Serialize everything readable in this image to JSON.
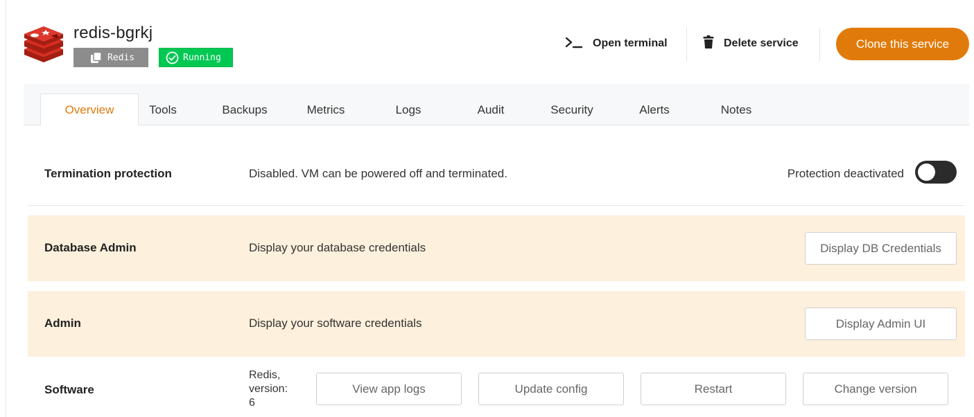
{
  "service": {
    "name": "redis-bgrkj",
    "type_badge": "Redis",
    "status_badge": "Running",
    "logo_icon": "redis-logo-icon"
  },
  "actions": {
    "open_terminal": {
      "label": "Open terminal",
      "icon": "terminal-icon"
    },
    "delete_service": {
      "label": "Delete service",
      "icon": "trash-icon"
    },
    "clone_service": {
      "label": "Clone this service"
    }
  },
  "tabs": [
    {
      "label": "Overview",
      "active": true
    },
    {
      "label": "Tools"
    },
    {
      "label": "Backups"
    },
    {
      "label": "Metrics"
    },
    {
      "label": "Logs"
    },
    {
      "label": "Audit"
    },
    {
      "label": "Security"
    },
    {
      "label": "Alerts"
    },
    {
      "label": "Notes"
    }
  ],
  "termination": {
    "label": "Termination protection",
    "description": "Disabled. VM can be powered off and terminated.",
    "toggle_label": "Protection deactivated",
    "enabled": false
  },
  "db_admin": {
    "label": "Database Admin",
    "description": "Display your database credentials",
    "button": "Display DB Credentials"
  },
  "admin": {
    "label": "Admin",
    "description": "Display your software credentials",
    "button": "Display Admin UI"
  },
  "software": {
    "label": "Software",
    "version_lines": [
      "Redis,",
      "version:",
      "6"
    ],
    "buttons": {
      "view_logs": "View app logs",
      "update_config": "Update config",
      "restart": "Restart",
      "change_version": "Change version"
    }
  },
  "colors": {
    "accent": "#e07b0b",
    "running": "#00c853",
    "type_badge": "#8c8c8c",
    "row_tint": "#fdf0dc",
    "redis_red": "#c6302b"
  }
}
